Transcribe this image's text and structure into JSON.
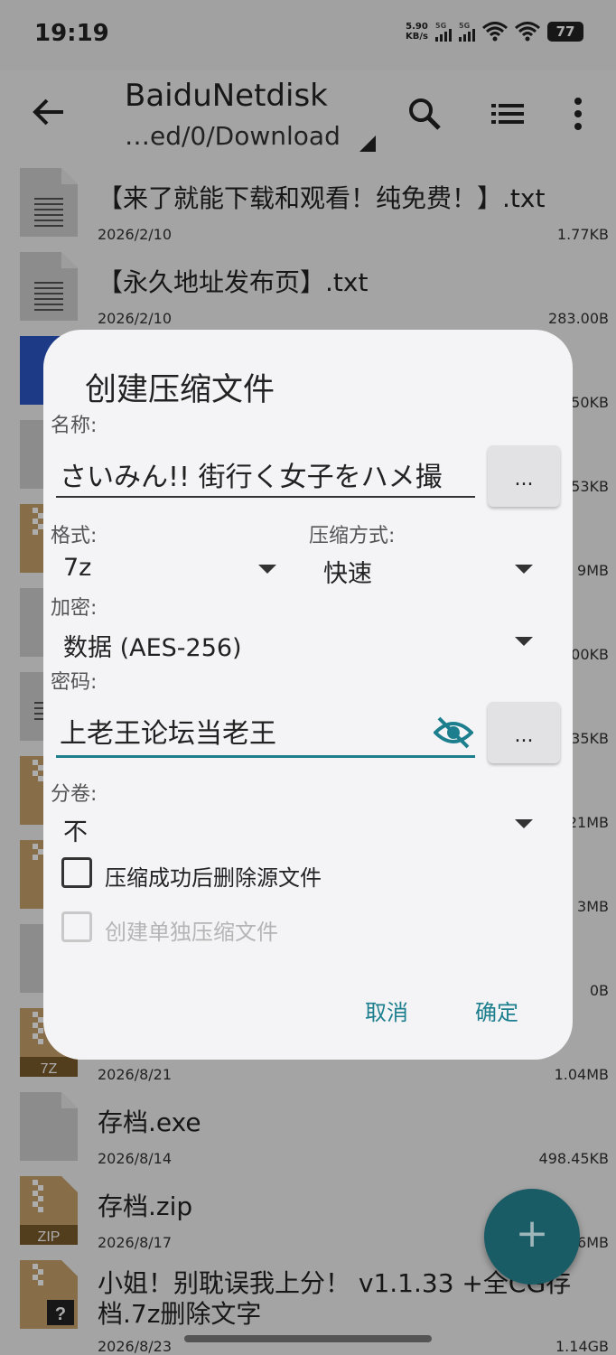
{
  "status": {
    "time": "19:19",
    "speed_value": "5.90",
    "speed_unit": "KB/s",
    "sim1": "5G",
    "sim2": "5G",
    "battery": "77"
  },
  "appbar": {
    "title": "BaiduNetdisk",
    "path": "…ed/0/Download"
  },
  "files": [
    {
      "name": "【来了就能下载和观看！纯免费！】.txt",
      "date": "2026/2/10",
      "size": "1.77KB"
    },
    {
      "name": "【永久地址发布页】.txt",
      "date": "2026/2/10",
      "size": "283.00B"
    },
    {
      "name": "",
      "date": "",
      "size": "50KB"
    },
    {
      "name": "",
      "date": "",
      "size": "53KB"
    },
    {
      "name": "",
      "date": "",
      "size": "9MB"
    },
    {
      "name": "",
      "date": "",
      "size": "00KB"
    },
    {
      "name": "",
      "date": "",
      "size": "35KB"
    },
    {
      "name": "",
      "date": "",
      "size": "21MB"
    },
    {
      "name": "",
      "date": "",
      "size": "3MB"
    },
    {
      "name": "",
      "date": "",
      "size": "0B"
    },
    {
      "name": "",
      "date": "2026/8/21",
      "size": "1.04MB",
      "icon_label": "7Z"
    },
    {
      "name": "存档.exe",
      "date": "2026/8/14",
      "size": "498.45KB"
    },
    {
      "name": "存档.zip",
      "date": "2026/8/17",
      "size": "6MB",
      "icon_label": "ZIP"
    },
    {
      "name": "小姐！别耽误我上分！ v1.1.33 +全CG存",
      "name2": "档.7z删除文字",
      "date": "2026/8/23",
      "size": "1.14GB",
      "icon_label": "?"
    }
  ],
  "dialog": {
    "title": "创建压缩文件",
    "name_label": "名称:",
    "name_value": "さいみん!! 街行く女子をハメ撮",
    "dots": "...",
    "format_label": "格式:",
    "format_value": "7z",
    "method_label": "压缩方式:",
    "method_value": "快速",
    "encrypt_label": "加密:",
    "encrypt_value": "数据 (AES-256)",
    "password_label": "密码:",
    "password_value": "上老王论坛当老王",
    "split_label": "分卷:",
    "split_value": "不",
    "delete_source_label": "压缩成功后删除源文件",
    "separate_label": "创建单独压缩文件",
    "cancel": "取消",
    "ok": "确定"
  },
  "fab": {
    "symbol": "+"
  },
  "colors": {
    "accent": "#1d7f8e",
    "fab": "#1a5c66",
    "dialog_bg": "#f4f4f6"
  }
}
